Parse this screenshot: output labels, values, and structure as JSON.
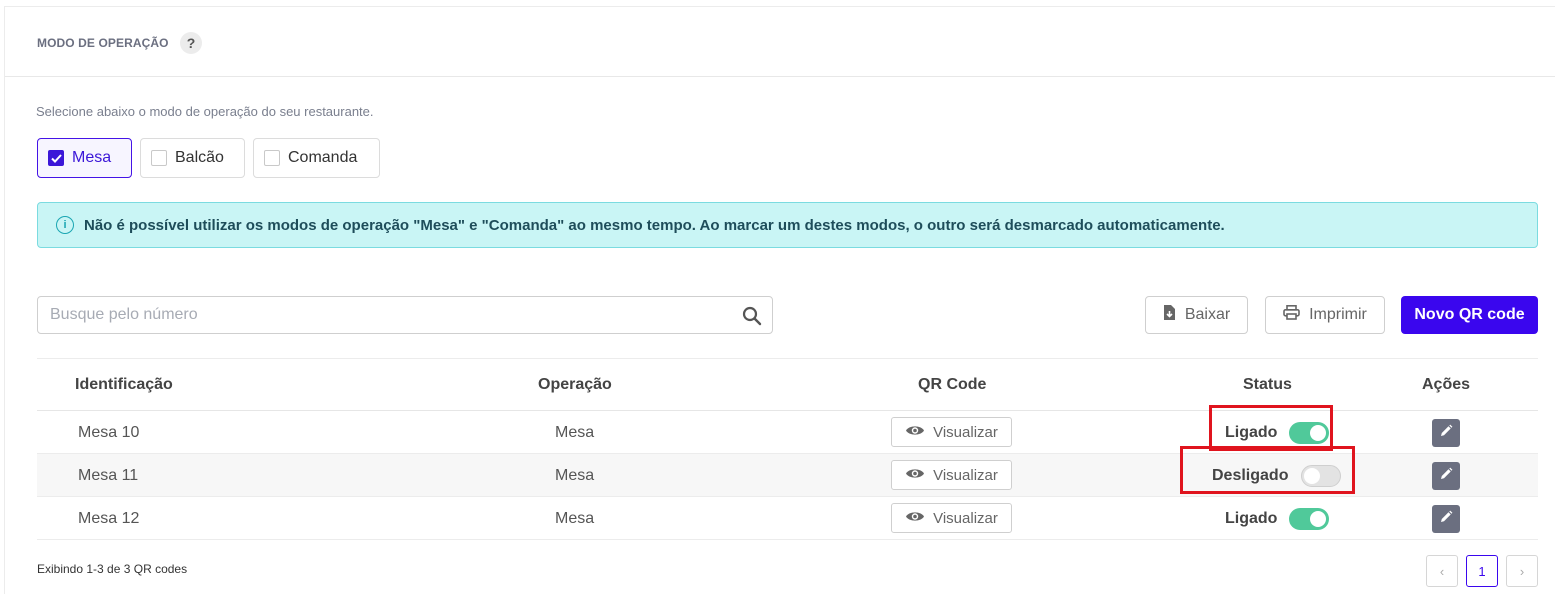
{
  "section": {
    "title": "MODO DE OPERAÇÃO",
    "help": "?"
  },
  "subtitle": "Selecione abaixo o modo de operação do seu restaurante.",
  "modes": [
    {
      "label": "Mesa",
      "checked": true
    },
    {
      "label": "Balcão",
      "checked": false
    },
    {
      "label": "Comanda",
      "checked": false
    }
  ],
  "alert": {
    "icon": "info-icon",
    "text": "Não é possível utilizar os modos de operação \"Mesa\" e \"Comanda\" ao mesmo tempo. Ao marcar um destes modos, o outro será desmarcado automaticamente."
  },
  "search": {
    "placeholder": "Busque pelo número"
  },
  "toolbar": {
    "download_label": "Baixar",
    "print_label": "Imprimir",
    "new_label": "Novo QR code"
  },
  "table": {
    "headers": {
      "id": "Identificação",
      "operation": "Operação",
      "qrcode": "QR Code",
      "status": "Status",
      "actions": "Ações"
    },
    "view_label": "Visualizar",
    "rows": [
      {
        "id": "Mesa 10",
        "operation": "Mesa",
        "status": "Ligado",
        "on": true
      },
      {
        "id": "Mesa 11",
        "operation": "Mesa",
        "status": "Desligado",
        "on": false
      },
      {
        "id": "Mesa 12",
        "operation": "Mesa",
        "status": "Ligado",
        "on": true
      }
    ]
  },
  "footer": {
    "summary": "Exibindo 1-3 de 3 QR codes",
    "prev": "‹",
    "page": "1",
    "next": "›"
  },
  "colors": {
    "accent": "#3a06ee",
    "toggle_on": "#50c99a",
    "alert_bg": "#c9f5f5",
    "highlight": "#e0141e"
  }
}
